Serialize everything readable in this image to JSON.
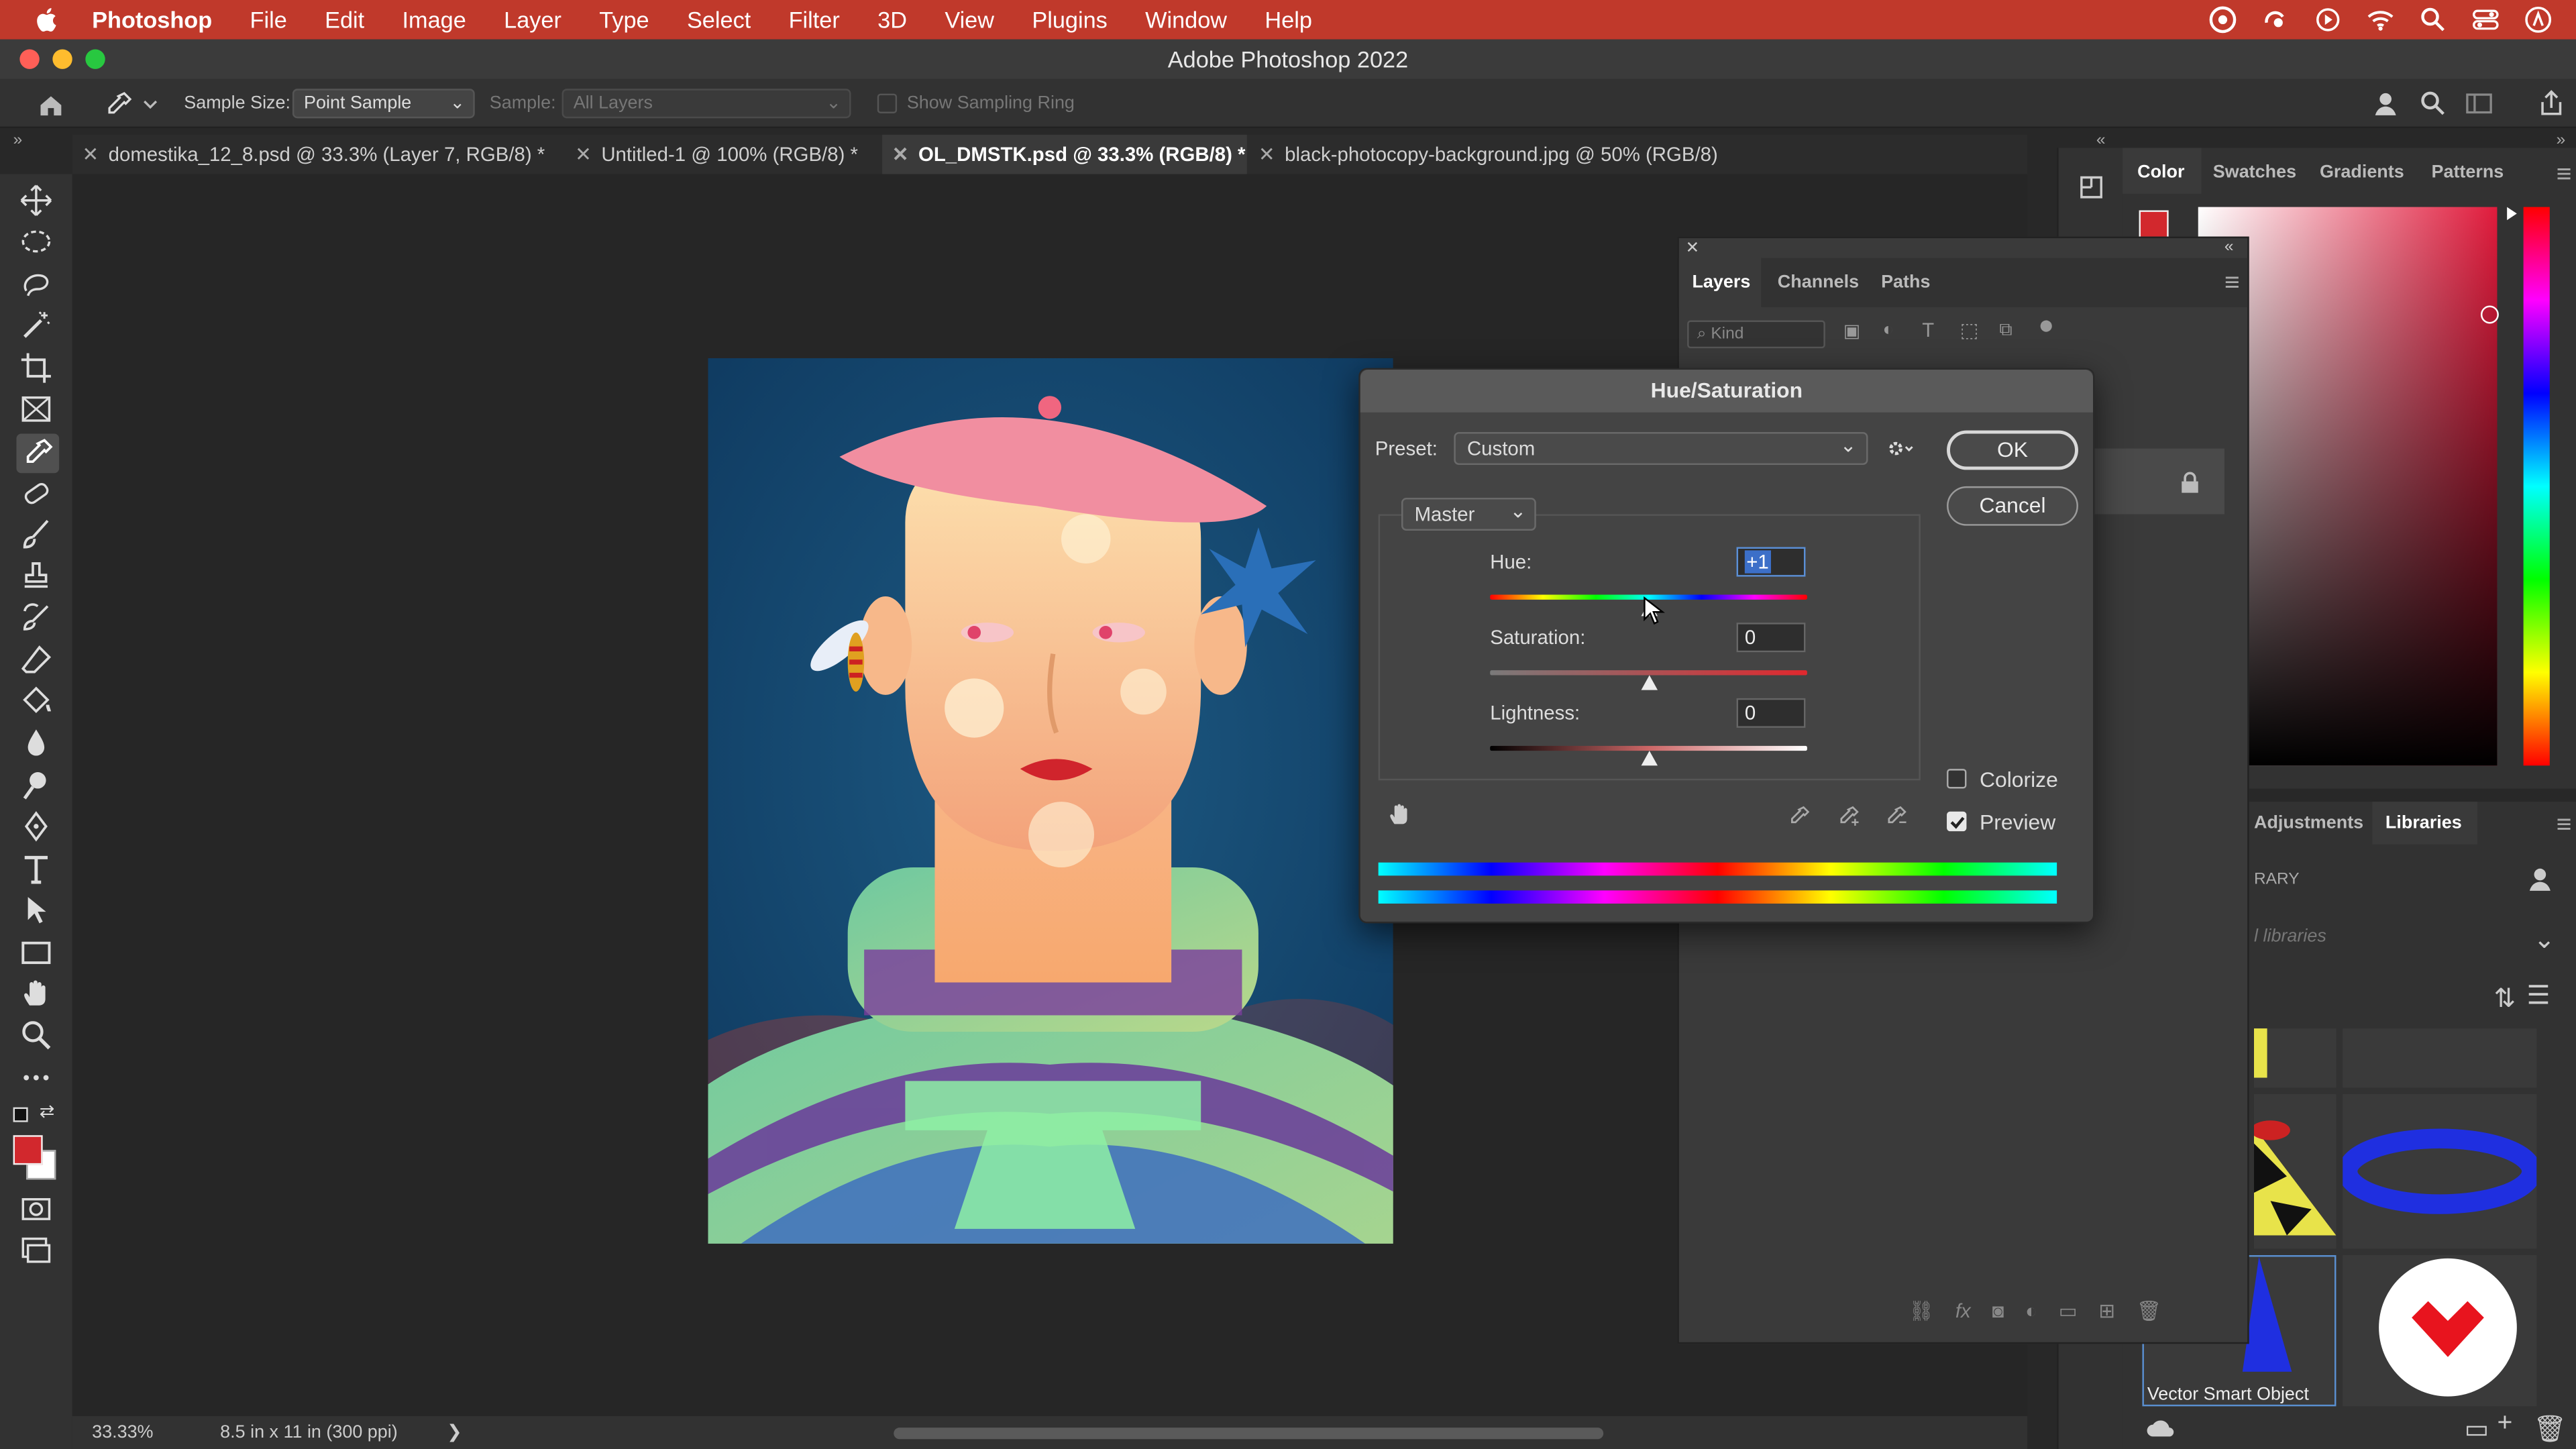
{
  "menubar": {
    "app": "Photoshop",
    "items": [
      "File",
      "Edit",
      "Image",
      "Layer",
      "Type",
      "Select",
      "Filter",
      "3D",
      "View",
      "Plugins",
      "Window",
      "Help"
    ]
  },
  "window": {
    "title": "Adobe Photoshop 2022"
  },
  "options": {
    "sample_size_label": "Sample Size:",
    "sample_size_value": "Point Sample",
    "sample_label": "Sample:",
    "sample_value": "All Layers",
    "show_ring_label": "Show Sampling Ring"
  },
  "tabs": [
    {
      "label": "domestika_12_8.psd @ 33.3% (Layer 7, RGB/8) *"
    },
    {
      "label": "Untitled-1 @ 100% (RGB/8) *"
    },
    {
      "label": "OL_DMSTK.psd @ 33.3% (RGB/8) *"
    },
    {
      "label": "black-photocopy-background.jpg @ 50% (RGB/8)"
    }
  ],
  "status": {
    "zoom": "33.33%",
    "doc_info": "8.5 in x 11 in (300 ppi)",
    "arrow": "❯"
  },
  "color_panel": {
    "tabs": [
      "Color",
      "Swatches",
      "Gradients",
      "Patterns"
    ]
  },
  "layers_panel": {
    "tabs": [
      "Layers",
      "Channels",
      "Paths"
    ],
    "kind_placeholder": "Kind"
  },
  "libraries_panel": {
    "tabs": [
      "Adjustments",
      "Libraries"
    ],
    "library_label": "RARY",
    "libraries_placeholder": "l libraries",
    "item_label": "Vector Smart Object"
  },
  "hue_sat": {
    "title": "Hue/Saturation",
    "preset_label": "Preset:",
    "preset_value": "Custom",
    "ok": "OK",
    "cancel": "Cancel",
    "channel": "Master",
    "hue_label": "Hue:",
    "hue_value": "+1",
    "hue_position": 0.505,
    "sat_label": "Saturation:",
    "sat_value": "0",
    "sat_position": 0.5,
    "light_label": "Lightness:",
    "light_value": "0",
    "light_position": 0.5,
    "colorize_label": "Colorize",
    "colorize_checked": false,
    "preview_label": "Preview",
    "preview_checked": true
  },
  "colors": {
    "accent_red": "#c0392b",
    "foreground": "#d2282d",
    "background": "#ffffff"
  }
}
